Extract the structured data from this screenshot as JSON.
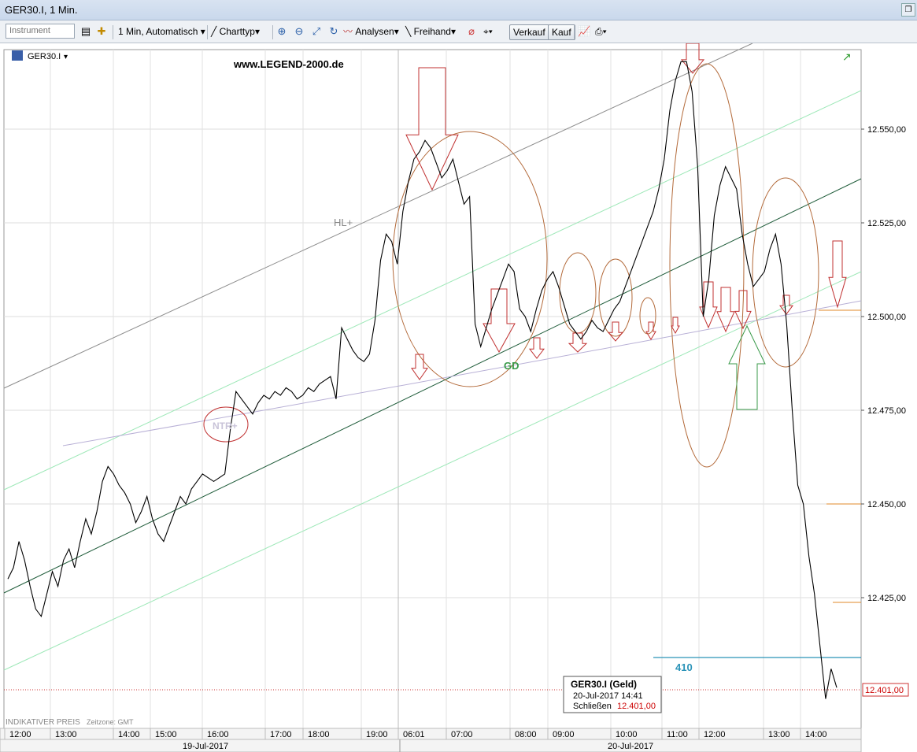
{
  "window": {
    "title": "GER30.I, 1 Min."
  },
  "toolbar": {
    "instrument_placeholder": "Instrument",
    "interval": "1 Min,  Automatisch",
    "chart_type": "Charttyp",
    "analyses": "Analysen",
    "freehand": "Freihand",
    "sell": "Verkauf",
    "buy": "Kauf"
  },
  "chart_data": {
    "type": "line",
    "instrument_label": "GER30.I",
    "website": "www.LEGEND-2000.de",
    "yticks": [
      12550,
      12525,
      12500,
      12475,
      12450,
      12425
    ],
    "ytick_labels": [
      "12.550,00",
      "12.525,00",
      "12.500,00",
      "12.475,00",
      "12.450,00",
      "12.425,00"
    ],
    "ylim": [
      12392,
      12572
    ],
    "xtick_labels": [
      "12:00",
      "13:00",
      "14:00",
      "15:00",
      "16:00",
      "17:00",
      "18:00",
      "19:00",
      "06:01",
      "07:00",
      "08:00",
      "09:00",
      "10:00",
      "11:00",
      "12:00",
      "13:00",
      "14:00"
    ],
    "date_labels": [
      "19-Jul-2017",
      "20-Jul-2017"
    ],
    "annotations": {
      "hl": "HL+",
      "gd": "GD",
      "ntr": "NTR+",
      "points": "410"
    },
    "footer_left": "INDIKATIVER PREIS",
    "footer_tz": "Zeitzone: GMT",
    "last_price_label": "12.401,00",
    "tooltip": {
      "title": "GER30.I (Geld)",
      "datetime": "20-Jul-2017 14:41",
      "close_label": "Schließen",
      "close_value": "12.401,00"
    },
    "series": [
      {
        "values": [
          12430,
          12433,
          12440,
          12435,
          12428,
          12422,
          12420,
          12426,
          12432,
          12428,
          12435,
          12438,
          12433,
          12440,
          12446,
          12442,
          12448,
          12456,
          12460,
          12458,
          12455,
          12453,
          12450,
          12445,
          12448,
          12452,
          12446,
          12442,
          12440,
          12444,
          12448,
          12452,
          12450,
          12454,
          12456,
          12458,
          12457,
          12456,
          12457,
          12458,
          12470,
          12480,
          12478,
          12476,
          12474,
          12477,
          12479,
          12478,
          12480,
          12479,
          12481,
          12480,
          12478,
          12479,
          12481,
          12480,
          12482,
          12483,
          12484,
          12478,
          12497,
          12494,
          12491,
          12489,
          12488,
          12490,
          12499,
          12515,
          12522,
          12520,
          12514,
          12528,
          12536,
          12542,
          12544,
          12547,
          12545,
          12541,
          12537,
          12539,
          12542,
          12536,
          12530,
          12532,
          12498,
          12492,
          12497,
          12502,
          12506,
          12510,
          12514,
          12512,
          12502,
          12500,
          12496,
          12502,
          12507,
          12510,
          12512,
          12508,
          12503,
          12498,
          12496,
          12494,
          12496,
          12499,
          12497,
          12496,
          12499,
          12502,
          12504,
          12508,
          12512,
          12516,
          12520,
          12524,
          12528,
          12534,
          12542,
          12555,
          12563,
          12568,
          12568,
          12560,
          12540,
          12500,
          12510,
          12527,
          12535,
          12540,
          12537,
          12534,
          12522,
          12514,
          12508,
          12510,
          12512,
          12518,
          12522,
          12514,
          12498,
          12475,
          12455,
          12450,
          12436,
          12426,
          12412,
          12398,
          12406,
          12401
        ]
      }
    ]
  }
}
